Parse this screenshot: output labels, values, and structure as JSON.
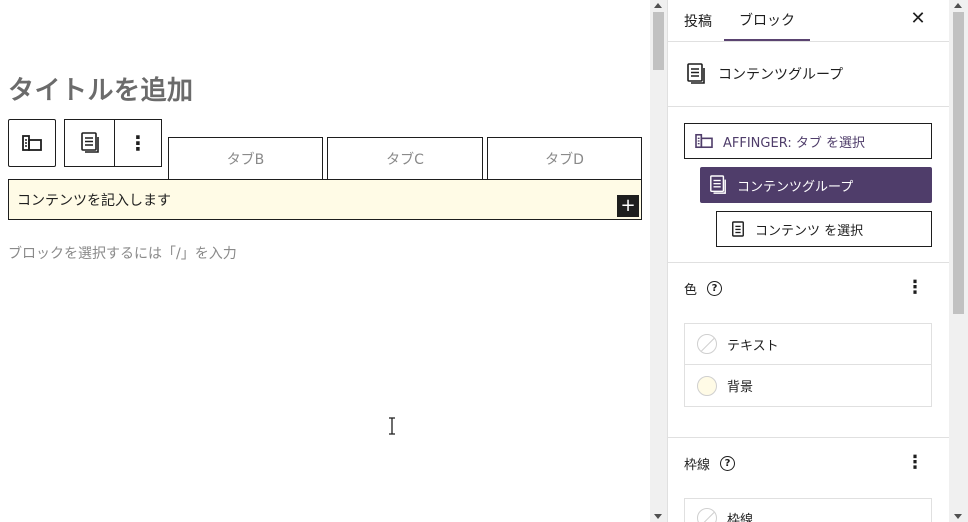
{
  "editor": {
    "title_placeholder": "タイトルを追加",
    "tabs": [
      "タブB",
      "タブC",
      "タブD"
    ],
    "content_text": "コンテンツを記入します",
    "add_icon": "+",
    "block_hint": "ブロックを選択するには「/」を入力",
    "toolbar": {
      "parent_icon": "tabs-block-icon",
      "block_icon": "document-icon",
      "more_label": "⋮"
    }
  },
  "sidebar": {
    "tabs": [
      {
        "label": "投稿",
        "active": false
      },
      {
        "label": "ブロック",
        "active": true
      }
    ],
    "close_label": "✕",
    "block_card": {
      "icon": "document-icon",
      "name": "コンテンツグループ"
    },
    "navigation": [
      {
        "icon": "tabs-block-icon",
        "label": "AFFINGER: タブ を選択"
      },
      {
        "icon": "document-icon",
        "label": "コンテンツグループ",
        "selected": true
      },
      {
        "icon": "document-icon",
        "label": "コンテンツ を選択"
      }
    ],
    "color_panel": {
      "title": "色",
      "help": "?",
      "menu": "⋮",
      "items": [
        {
          "label": "テキスト",
          "swatch": "none"
        },
        {
          "label": "背景",
          "swatch": "#fffbe6"
        }
      ]
    },
    "border_panel": {
      "title": "枠線",
      "help": "?",
      "menu": "⋮",
      "items": [
        {
          "label": "枠線",
          "swatch": "none"
        }
      ]
    }
  },
  "colors": {
    "accent": "#4f3d6a",
    "content_bg": "#fffbe6"
  }
}
